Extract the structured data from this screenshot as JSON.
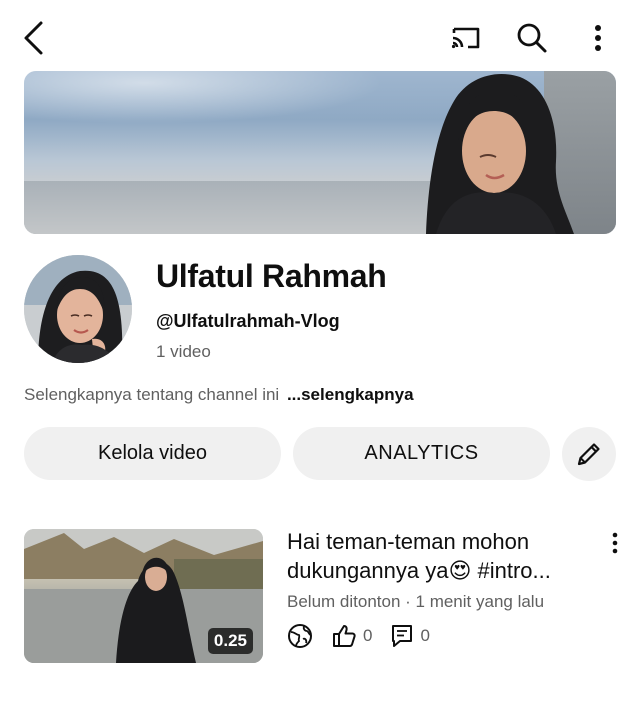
{
  "toolbar": {
    "back_icon": "chevron-left-icon",
    "cast_icon": "cast-icon",
    "search_icon": "search-icon",
    "more_icon": "more-vertical-icon"
  },
  "channel": {
    "name": "Ulfatul Rahmah",
    "handle": "@Ulfatulrahmah-Vlog",
    "video_count": "1 video",
    "about_text": "Selengkapnya tentang channel ini",
    "about_more": "...selengkapnya"
  },
  "actions": {
    "manage_label": "Kelola video",
    "analytics_label": "ANALYTICS",
    "edit_icon": "pencil-icon"
  },
  "video": {
    "title": "Hai teman-teman mohon dukungannya ya😍 #intro...",
    "duration": "0.25",
    "meta": "Belum ditonton · 1 menit yang lalu",
    "likes": "0",
    "comments": "0",
    "visibility_icon": "globe-icon",
    "like_icon": "thumbs-up-icon",
    "comment_icon": "comment-icon"
  },
  "colors": {
    "text_primary": "#0f0f0f",
    "text_secondary": "#606060",
    "pill_bg": "#f0f0f0"
  }
}
